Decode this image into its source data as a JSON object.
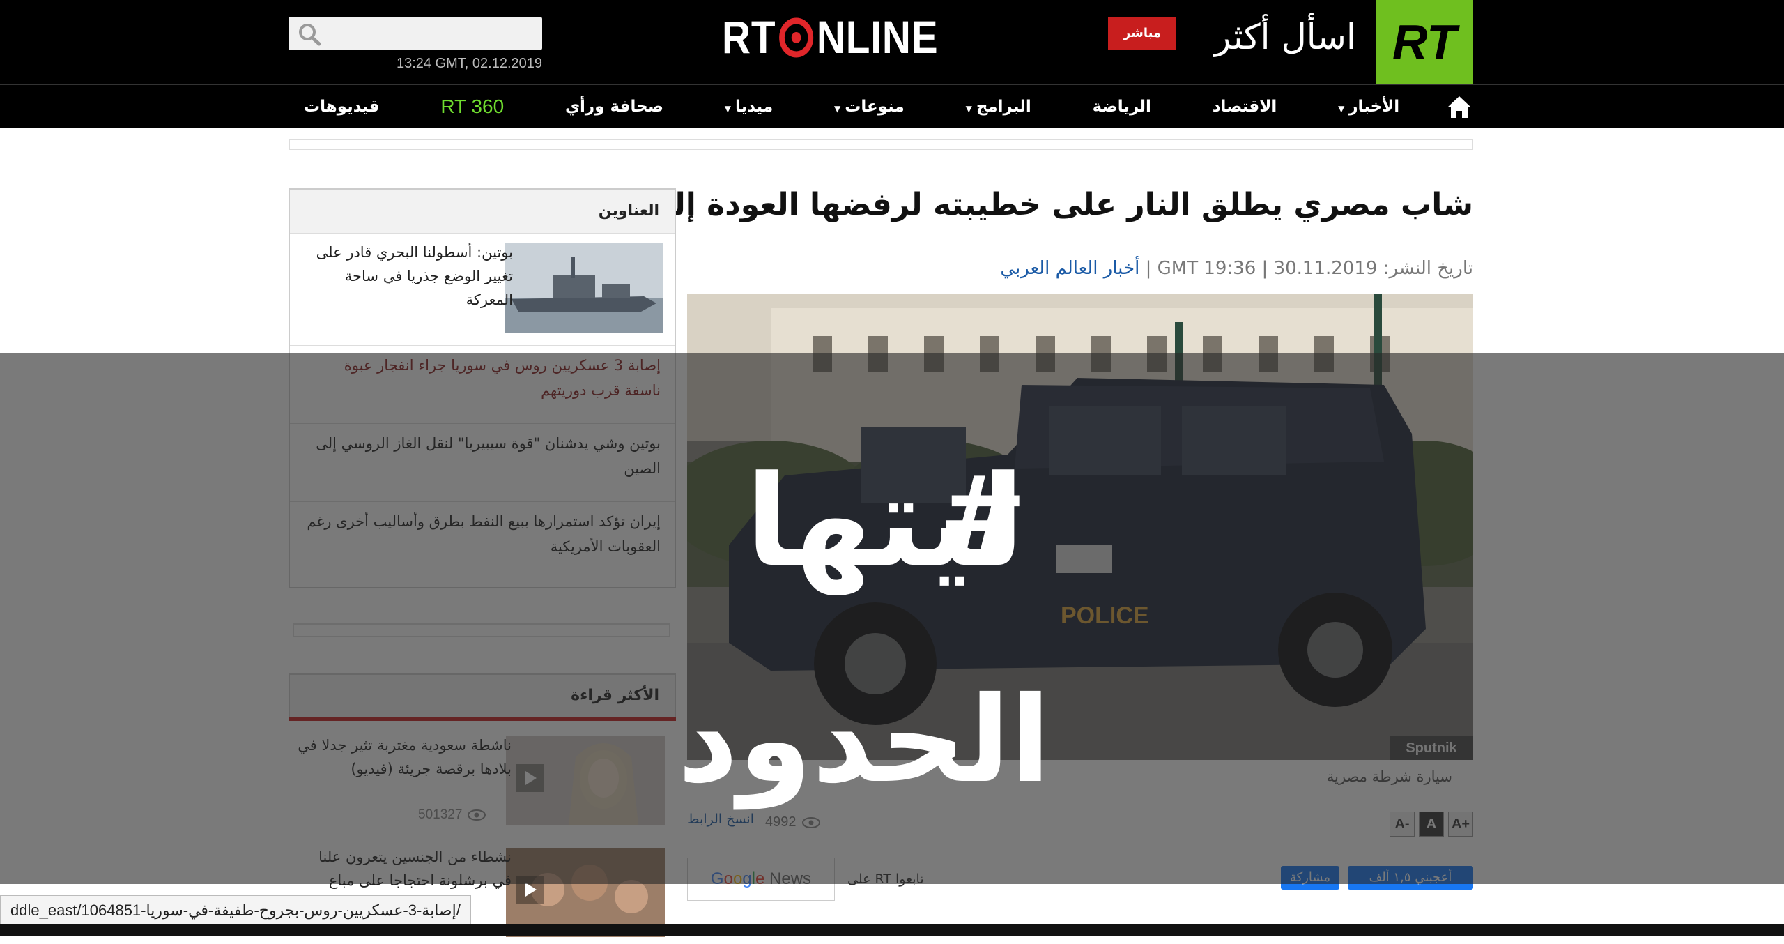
{
  "header": {
    "search_placeholder": "",
    "datetime": "13:24 GMT, 02.12.2019",
    "logo_left": "RT",
    "logo_right": "NLINE",
    "live_label": "مباشر",
    "slogan": "اسأل أكثر",
    "rt_logo": "RT",
    "brand_green": "#6fbf1f",
    "live_red": "#c81e1e"
  },
  "nav": {
    "items": [
      {
        "label": "الأخبار",
        "dropdown": true
      },
      {
        "label": "الاقتصاد",
        "dropdown": false
      },
      {
        "label": "الرياضة",
        "dropdown": false
      },
      {
        "label": "البرامج",
        "dropdown": true
      },
      {
        "label": "منوعات",
        "dropdown": true
      },
      {
        "label": "ميديا",
        "dropdown": true
      },
      {
        "label": "صحافة ورأي",
        "dropdown": false
      },
      {
        "label": "RT 360",
        "dropdown": false
      },
      {
        "label": "قيديوهات",
        "dropdown": false
      }
    ]
  },
  "article": {
    "title": "شاب مصري يطلق النار على خطيبته لرفضها العودة إليه",
    "published_label": "تاريخ النشر:",
    "published_date": "30.11.2019",
    "published_time": "GMT 19:36",
    "category": "أخبار العالم العربي",
    "photo_credit": "Sputnik",
    "photo_badge": "POLICE",
    "caption": "سيارة شرطة مصرية",
    "copy_link": "انسخ الرابط",
    "views": "4992",
    "font_sizes": [
      "A-",
      "A",
      "A+"
    ],
    "follow_text": "تابعوا RT على",
    "google_news": {
      "g1": "G",
      "g2": "o",
      "g3": "o",
      "g4": "g",
      "g5": "l",
      "g6": "e",
      "news": " News"
    },
    "fb_like": "أعجبني ١,٥ ألف",
    "fb_share": "مشاركة"
  },
  "sidebar": {
    "title": "العناوين",
    "feature": "بوتين: أسطولنا البحري قادر على تغيير الوضع جذريا في ساحة المعركة",
    "items": [
      {
        "text": "إصابة 3 عسكريين روس في سوريا جراء انفجار عبوة ناسفة قرب دوريتهم"
      },
      {
        "text": "بوتين وشي يدشنان \"قوة سيبيريا\" لنقل الغاز الروسي إلى الصين"
      },
      {
        "text": "إيران تؤكد استمرارها ببيع النفط بطرق وأساليب أخرى رغم العقوبات الأمريكية"
      }
    ]
  },
  "most_read": {
    "title": "الأكثر قراءة",
    "items": [
      {
        "text": "ناشطة سعودية مغتربة تثير جدلا في بلادها برقصة جريئة (فيديو)",
        "views": "501327"
      },
      {
        "text": "نشطاء من الجنسين يتعرون علنا في برشلونة احتجاجا على مباع",
        "views": ""
      }
    ]
  },
  "overlay": {
    "hashtag": "#",
    "line1": "ليتها",
    "line2": "الحدود"
  },
  "statusbar": {
    "url": "ddle_east/1064851-إصابة-3-عسكريين-روس-بجروح-طفيفة-في-سوريا/"
  }
}
